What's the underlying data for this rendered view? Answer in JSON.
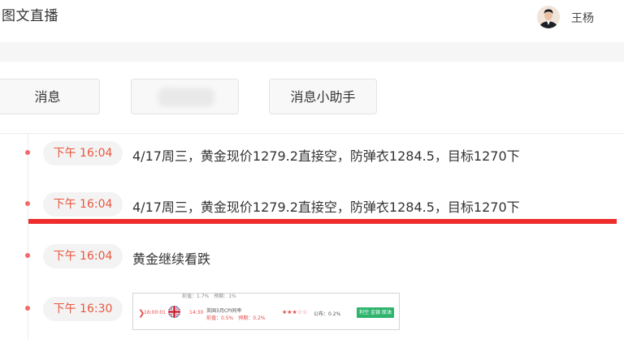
{
  "header": {
    "title": "图文直播",
    "user_name": "王杨"
  },
  "tabs": [
    {
      "label": "消息"
    },
    {
      "label": ""
    },
    {
      "label": "消息小助手"
    }
  ],
  "timeline": [
    {
      "time": "下午 16:04",
      "text": "4/17周三，黄金现价1279.2直接空，防弹衣1284.5，目标1270下"
    },
    {
      "time": "下午 16:04",
      "text": "4/17周三，黄金现价1279.2直接空，防弹衣1284.5，目标1270下"
    },
    {
      "time": "下午 16:04",
      "text": "黄金继续看跌"
    },
    {
      "time": "下午 16:30",
      "text": ""
    }
  ],
  "embedded_card": {
    "top_text": "前值：1.7%　预期：1%",
    "time_left": "16:00:01",
    "time_right": "14:30",
    "line1": "英国3月CPI同率",
    "line2": "前值：0.5%　预期：0.2%",
    "stars": "★★★☆☆",
    "published": "公布：0.2%",
    "button": "利空 金银 原油"
  },
  "colors": {
    "accent_red": "#ee2c2c",
    "time_text": "#e8573f",
    "dot": "#f06a6a",
    "card_button": "#2fb46e"
  }
}
